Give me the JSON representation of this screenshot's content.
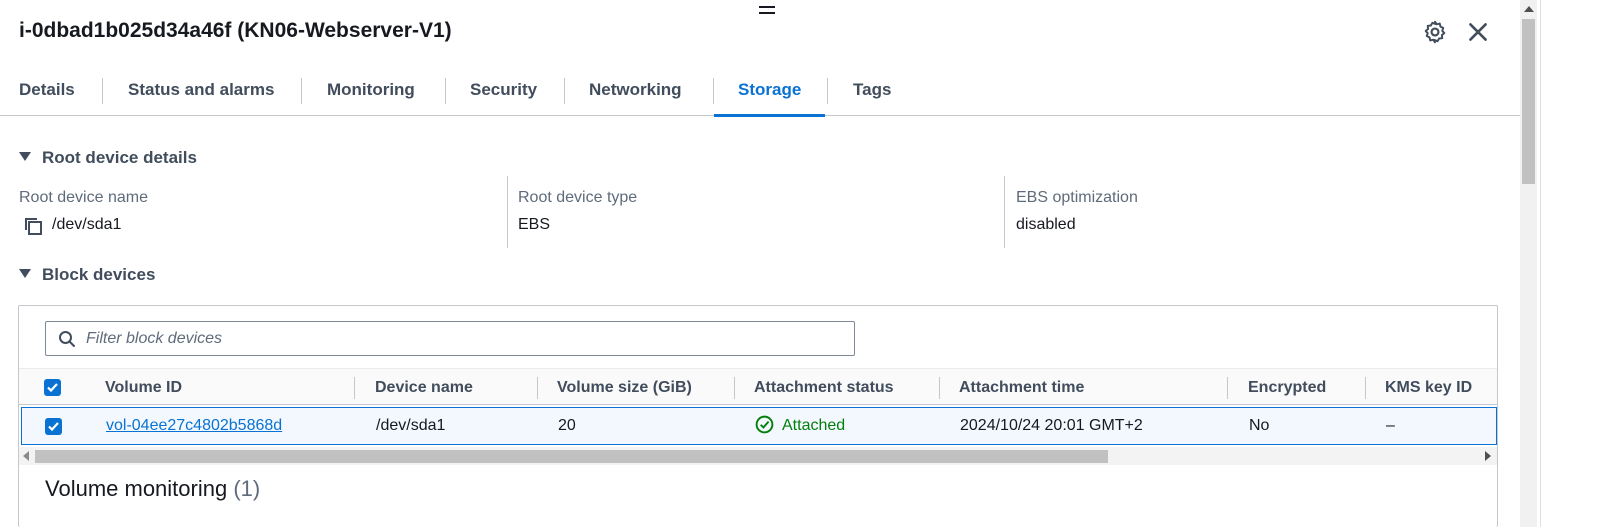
{
  "header": {
    "title": "i-0dbad1b025d34a46f (KN06-Webserver-V1)",
    "icons": [
      "drag-handle-icon",
      "gear-icon",
      "close-icon"
    ]
  },
  "tabs": [
    {
      "label": "Details"
    },
    {
      "label": "Status and alarms"
    },
    {
      "label": "Monitoring"
    },
    {
      "label": "Security"
    },
    {
      "label": "Networking"
    },
    {
      "label": "Storage",
      "active": true
    },
    {
      "label": "Tags"
    }
  ],
  "root_device": {
    "heading": "Root device details",
    "name_label": "Root device name",
    "name_value": "/dev/sda1",
    "type_label": "Root device type",
    "type_value": "EBS",
    "ebs_label": "EBS optimization",
    "ebs_value": "disabled"
  },
  "block_devices": {
    "heading": "Block devices",
    "filter_placeholder": "Filter block devices",
    "columns": [
      "Volume ID",
      "Device name",
      "Volume size (GiB)",
      "Attachment status",
      "Attachment time",
      "Encrypted",
      "KMS key ID"
    ],
    "rows": [
      {
        "volume_id": "vol-04ee27c4802b5868d",
        "device_name": "/dev/sda1",
        "size": "20",
        "status": "Attached",
        "time": "2024/10/24 20:01 GMT+2",
        "encrypted": "No",
        "kms": "–"
      }
    ]
  },
  "volume_monitoring": {
    "title": "Volume monitoring",
    "count": "(1)"
  },
  "colors": {
    "accent": "#0972d3",
    "success": "#037f0c",
    "text": "#16191f",
    "muted": "#5f6b7a"
  }
}
